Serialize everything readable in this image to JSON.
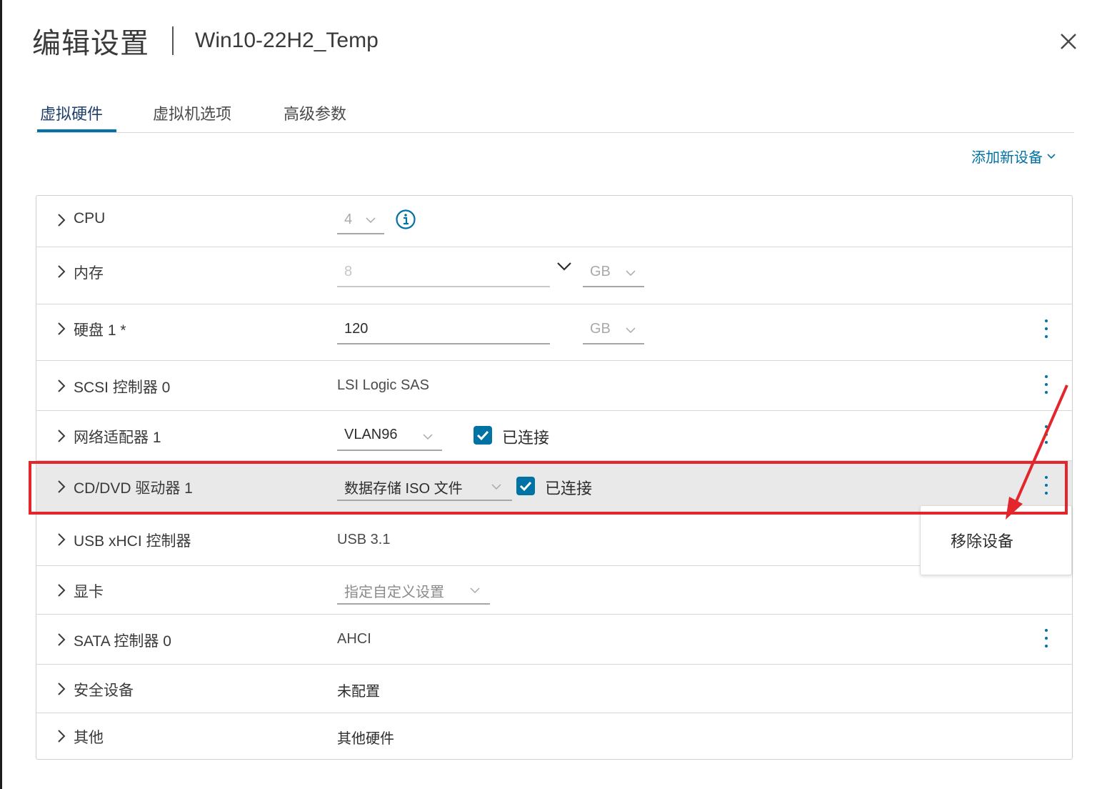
{
  "window": {
    "title": "编辑设置",
    "vm_name": "Win10-22H2_Temp"
  },
  "tabs": [
    {
      "label": "虚拟硬件",
      "active": true
    },
    {
      "label": "虚拟机选项",
      "active": false
    },
    {
      "label": "高级参数",
      "active": false
    }
  ],
  "toolbar": {
    "add_device_label": "添加新设备"
  },
  "hardware": {
    "cpu": {
      "label": "CPU",
      "value": "4"
    },
    "memory": {
      "label": "内存",
      "value": "8",
      "unit": "GB"
    },
    "disk1": {
      "label": "硬盘 1 *",
      "value": "120",
      "unit": "GB"
    },
    "scsi": {
      "label": "SCSI 控制器 0",
      "value": "LSI Logic SAS"
    },
    "network": {
      "label": "网络适配器 1",
      "value": "VLAN96",
      "connected_label": "已连接",
      "connected": true
    },
    "cddvd": {
      "label": "CD/DVD 驱动器 1",
      "value": "数据存储 ISO 文件",
      "connected_label": "已连接",
      "connected": true
    },
    "usb": {
      "label": "USB xHCI 控制器",
      "value": "USB 3.1"
    },
    "video": {
      "label": "显卡",
      "value": "指定自定义设置"
    },
    "sata": {
      "label": "SATA 控制器 0",
      "value": "AHCI"
    },
    "security": {
      "label": "安全设备",
      "value": "未配置"
    },
    "other": {
      "label": "其他",
      "value": "其他硬件"
    }
  },
  "context_menu": {
    "items": [
      {
        "label": "移除设备"
      }
    ]
  },
  "colors": {
    "accent": "#0072a3",
    "annotation": "#e3262c",
    "highlight_row": "#e9e9e9"
  },
  "icons": [
    "close-icon",
    "chevron-right-icon",
    "chevron-down-icon",
    "info-icon",
    "kebab-menu-icon",
    "checkbox-checked-icon"
  ]
}
